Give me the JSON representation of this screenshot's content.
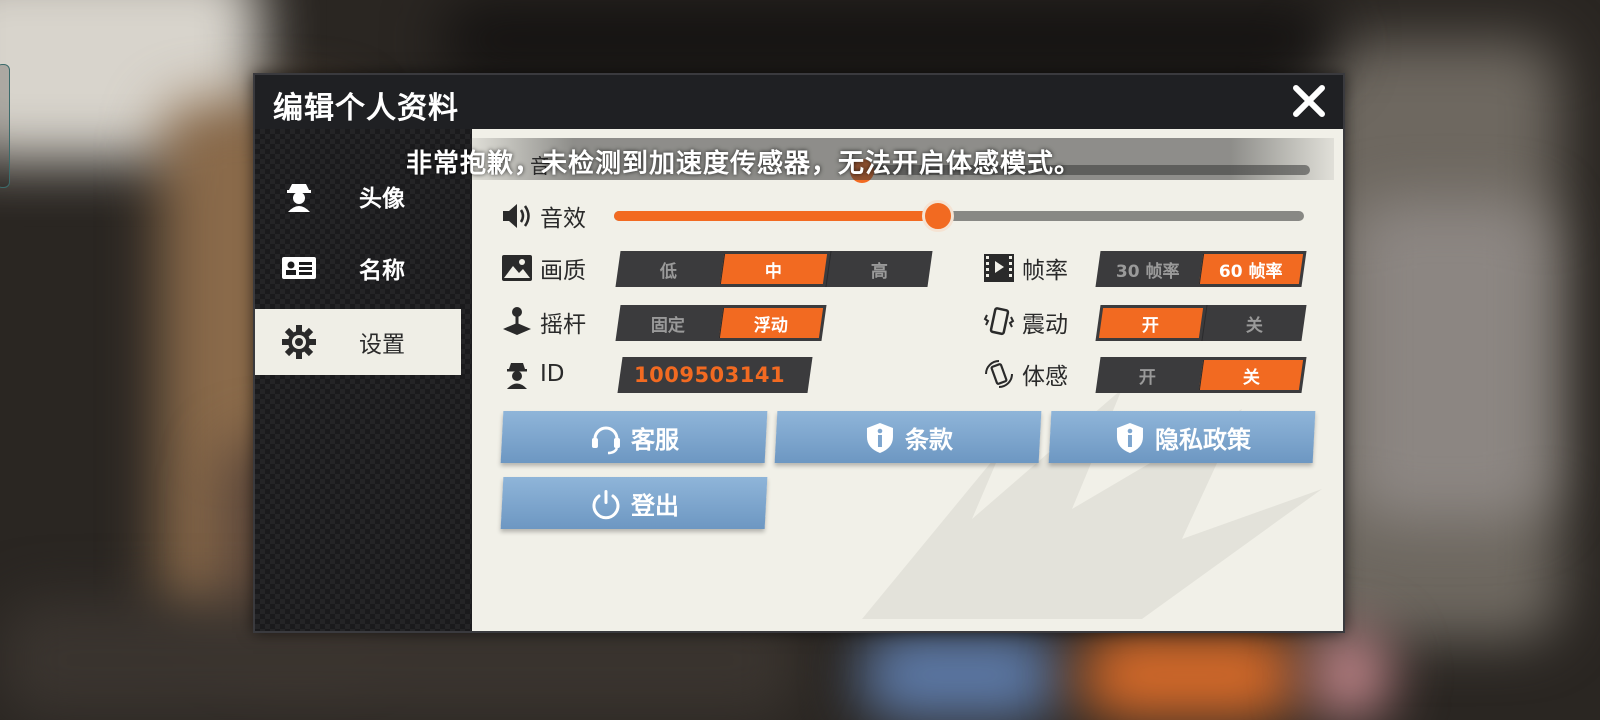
{
  "dialog": {
    "title": "编辑个人资料",
    "close_icon": "close-icon"
  },
  "sidebar": {
    "items": [
      {
        "label": "头像",
        "icon": "avatar-icon",
        "active": false
      },
      {
        "label": "名称",
        "icon": "id-card-icon",
        "active": false
      },
      {
        "label": "设置",
        "icon": "gear-icon",
        "active": true
      }
    ]
  },
  "settings": {
    "music_label_partial": "音",
    "sound_effect": {
      "label": "音效",
      "icon": "speaker-icon",
      "level": 0.47
    },
    "music": {
      "level": 0.38
    },
    "quality": {
      "label": "画质",
      "icon": "image-icon",
      "options": [
        "低",
        "中",
        "高"
      ],
      "selected": "中"
    },
    "frame_rate": {
      "label": "帧率",
      "icon": "film-icon",
      "options": [
        "30 帧率",
        "60 帧率"
      ],
      "selected": "60 帧率"
    },
    "joystick": {
      "label": "摇杆",
      "icon": "joystick-icon",
      "options": [
        "固定",
        "浮动"
      ],
      "selected": "浮动"
    },
    "vibration": {
      "label": "震动",
      "icon": "vibration-icon",
      "options": [
        "开",
        "关"
      ],
      "selected": "开"
    },
    "id": {
      "label": "ID",
      "icon": "agent-icon",
      "value": "1009503141"
    },
    "motion": {
      "label": "体感",
      "icon": "motion-icon",
      "options": [
        "开",
        "关"
      ],
      "selected": "关"
    }
  },
  "actions": {
    "customer_service": "客服",
    "terms": "条款",
    "privacy": "隐私政策",
    "logout": "登出"
  },
  "toast": {
    "message": "非常抱歉，未检测到加速度传感器，无法开启体感模式。"
  },
  "colors": {
    "accent": "#f26a21",
    "button_blue": "#7ea6cf",
    "panel": "#f1f0e8",
    "header": "#1f2023"
  }
}
